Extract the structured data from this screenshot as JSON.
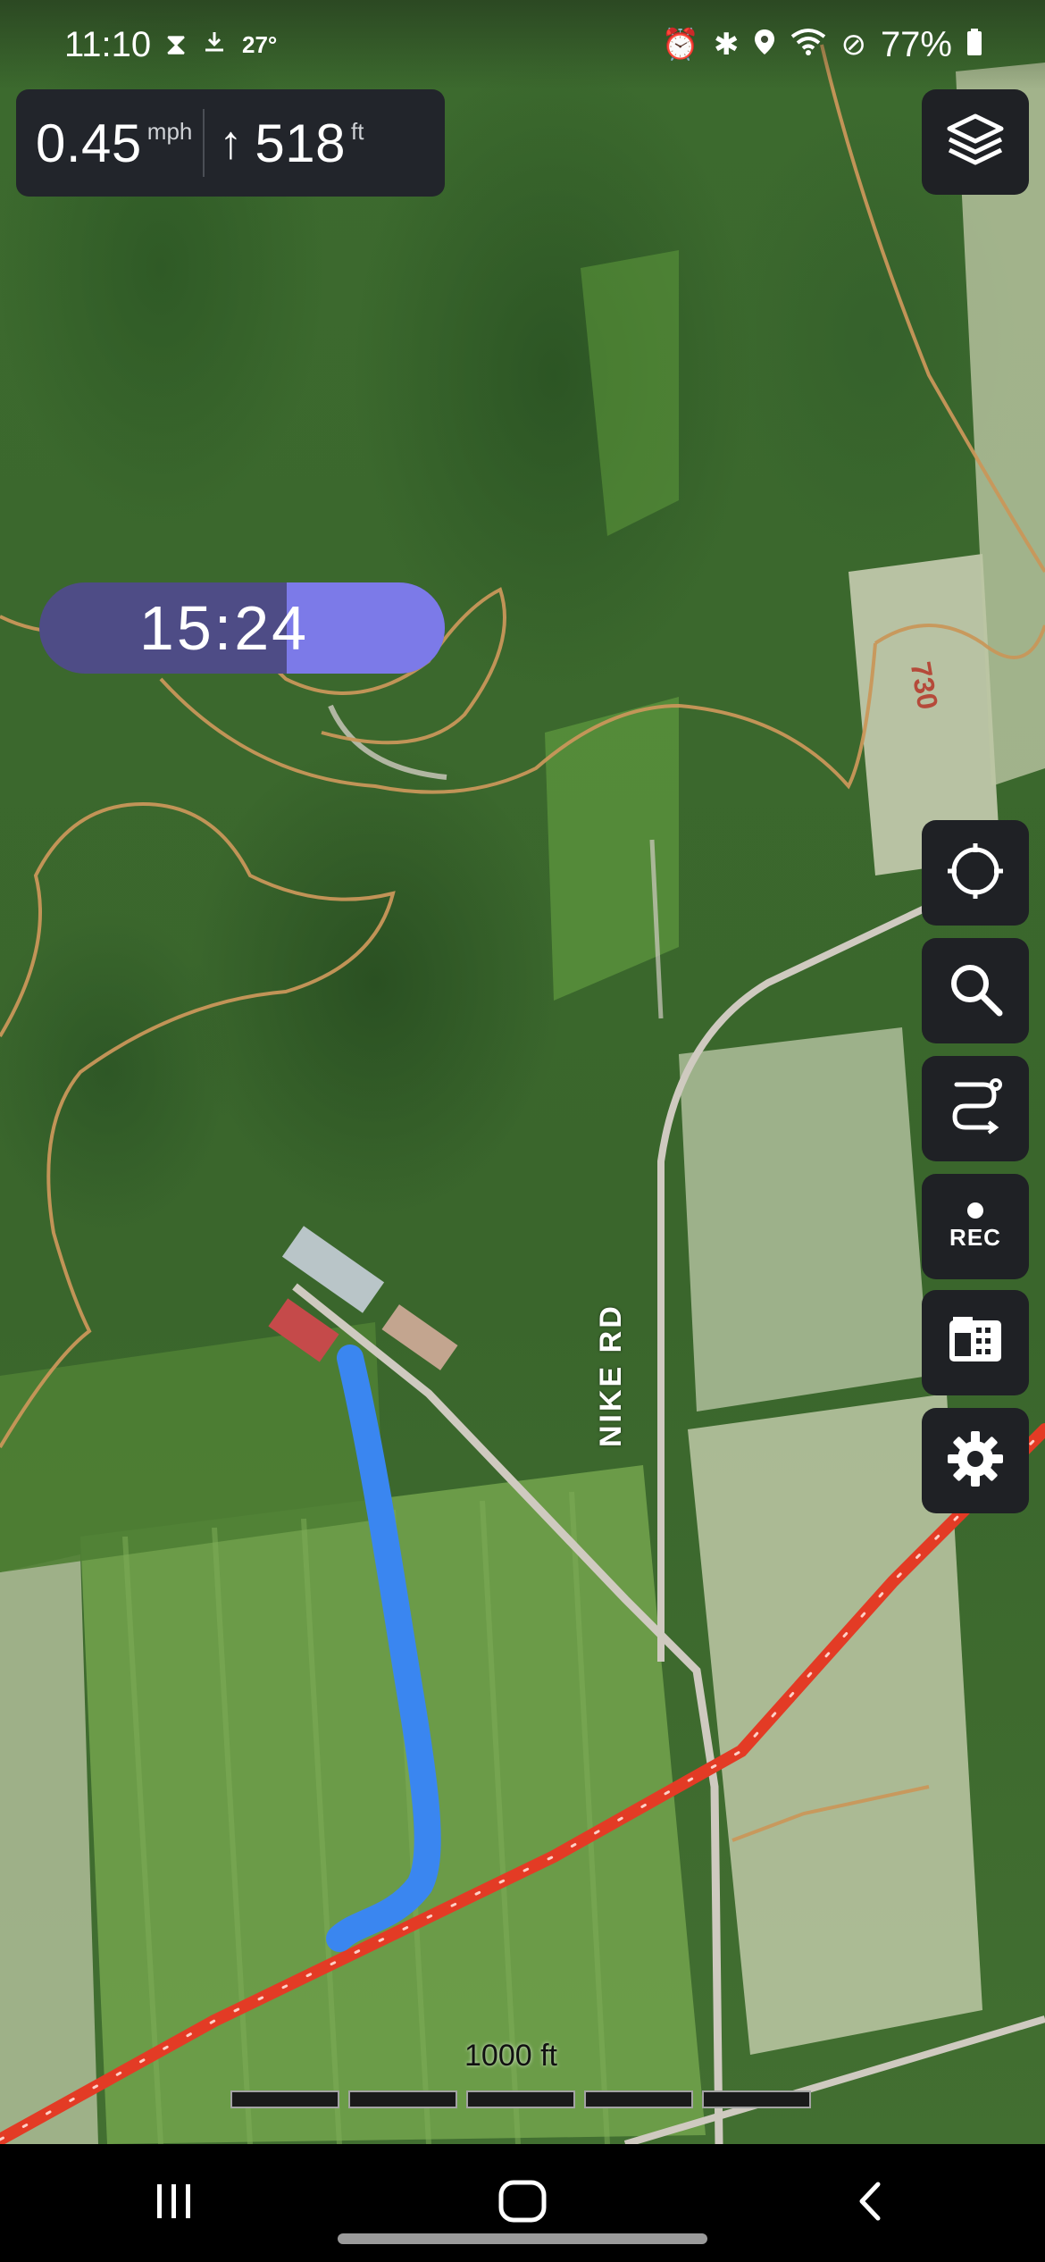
{
  "status_bar": {
    "time": "11:10",
    "temperature": "27°",
    "battery": "77%",
    "icons": [
      "hourglass-icon",
      "download-icon",
      "alarm-icon",
      "bluetooth-icon",
      "location-icon",
      "wifi-icon",
      "do-not-disturb-icon",
      "battery-icon"
    ]
  },
  "speed_panel": {
    "speed_value": "0.45",
    "speed_unit": "mph",
    "elevation_value": "518",
    "elevation_unit": "ft"
  },
  "timer": {
    "text": "15:24",
    "progress": 0.39
  },
  "map": {
    "road_label": "NIKE RD",
    "route_number": "730",
    "scale_label": "1000 ft",
    "scale_segments": 5,
    "colors": {
      "recorded_track": "#3a86f0",
      "highlighted_trail": "#e33b25",
      "trails": "#c9975a",
      "satellite_forest": "#2f5a26"
    }
  },
  "toolbar": {
    "layers": "layers-icon",
    "locate": "locate-icon",
    "search": "search-icon",
    "route": "route-icon",
    "record_label": "REC",
    "offline": "offline-maps-icon",
    "settings": "gear-icon"
  },
  "nav_bar": {
    "recents": "recents-icon",
    "home": "home-icon",
    "back": "back-icon"
  }
}
